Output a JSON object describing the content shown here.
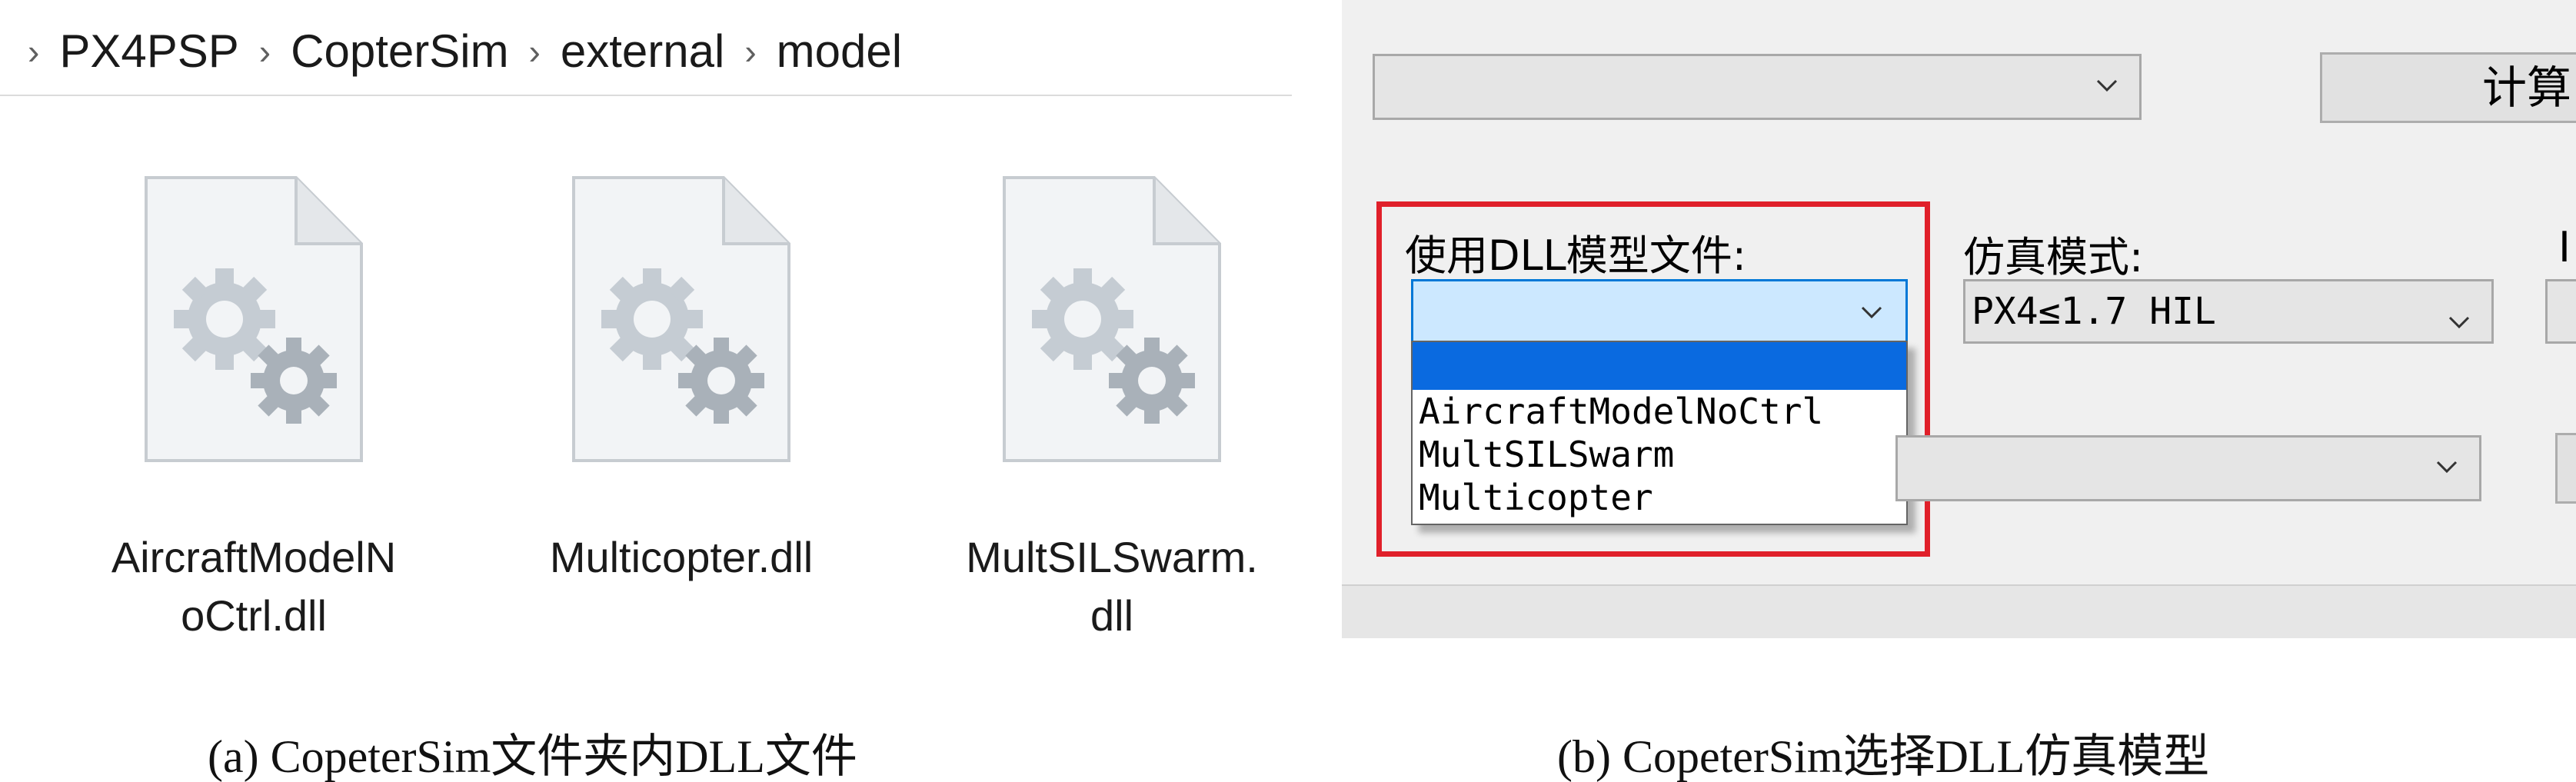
{
  "explorer": {
    "breadcrumb": [
      "PX4PSP",
      "CopterSim",
      "external",
      "model"
    ],
    "files": [
      {
        "name_lines": [
          "AircraftModelN",
          "oCtrl.dll"
        ],
        "icon": "dll-gear-file-icon"
      },
      {
        "name_lines": [
          "Multicopter.dll"
        ],
        "icon": "dll-gear-file-icon"
      },
      {
        "name_lines": [
          "MultSILSwarm.",
          "dll"
        ],
        "icon": "dll-gear-file-icon"
      }
    ]
  },
  "coptersim": {
    "top_combo_value": "",
    "calc_button_label": "计算",
    "dll_label": "使用DLL模型文件:",
    "dll_selected_value": "",
    "dll_options": [
      "",
      "AircraftModelNoCtrl",
      "MultSILSwarm",
      "Multicopter"
    ],
    "sim_mode_label": "仿真模式:",
    "sim_mode_value": "PX4≤1.7 HIL",
    "partial_label_char": "I",
    "lower_combo_value": "",
    "highlight_color": "#e0202a",
    "selection_color": "#0a6ae0"
  },
  "captions": {
    "a": "(a) CopeterSim文件夹内DLL文件",
    "b": "(b) CopeterSim选择DLL仿真模型"
  }
}
